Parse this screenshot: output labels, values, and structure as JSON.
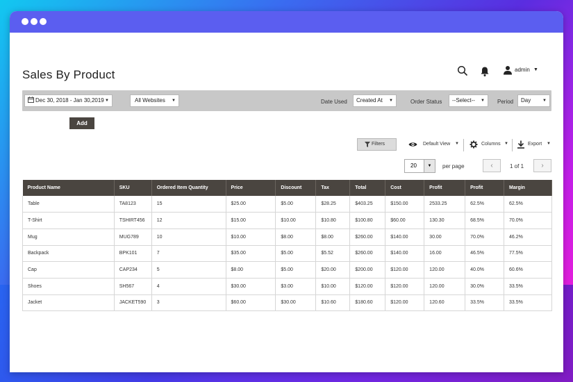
{
  "page_title": "Sales By Product",
  "user": {
    "name": "admin"
  },
  "icons": {
    "search": "search-icon",
    "bell": "bell-icon",
    "user": "user-icon",
    "calendar": "calendar-icon",
    "filter": "filter-icon",
    "eye": "eye-icon",
    "gear": "gear-icon",
    "download": "download-icon"
  },
  "filterbar": {
    "date_range": "Dec 30, 2018 - Jan 30,2019",
    "website": "All Websites",
    "date_used_label": "Date Used",
    "date_used_value": "Created At",
    "order_status_label": "Order Status",
    "order_status_value": "--Select--",
    "period_label": "Period",
    "period_value": "Day"
  },
  "add_label": "Add",
  "toolbar": {
    "filters_label": "Filters",
    "default_view_label": "Default View",
    "columns_label": "Columns",
    "export_label": "Export"
  },
  "pagination": {
    "per_page_value": "20",
    "per_page_label": "per page",
    "prev": "‹",
    "next": "›",
    "page_info": "1 of 1"
  },
  "table": {
    "headers": [
      "Product Name",
      "SKU",
      "Ordered Item Quantity",
      "Price",
      "Discount",
      "Tax",
      "Total",
      "Cost",
      "Profit",
      "Profit",
      "Margin"
    ],
    "rows": [
      [
        "Table",
        "TA8123",
        "15",
        "$25.00",
        "$5.00",
        "$28.25",
        "$403.25",
        "$150.00",
        "2533.25",
        "62.5%",
        "62.5%"
      ],
      [
        "T-Shirt",
        "TSHIRT456",
        "12",
        "$15.00",
        "$10.00",
        "$10.80",
        "$100.80",
        "$60.00",
        "130.30",
        "68.5%",
        "70.0%"
      ],
      [
        "Mug",
        "MUG789",
        "10",
        "$10.00",
        "$8.00",
        "$8.00",
        "$260.00",
        "$140.00",
        "30.00",
        "70.0%",
        "46.2%"
      ],
      [
        "Backpack",
        "BPK101",
        "7",
        "$35.00",
        "$5.00",
        "$5.52",
        "$260.00",
        "$140.00",
        "16.00",
        "46.5%",
        "77.5%"
      ],
      [
        "Cap",
        "CAP234",
        "5",
        "$8.00",
        "$5.00",
        "$20.00",
        "$200.00",
        "$120.00",
        "120.00",
        "40.0%",
        "60.6%"
      ],
      [
        "Shoes",
        "SH567",
        "4",
        "$30.00",
        "$3.00",
        "$10.00",
        "$120.00",
        "$120.00",
        "120.00",
        "30.0%",
        "33.5%"
      ],
      [
        "Jacket",
        "JACKET590",
        "3",
        "$60.00",
        "$30.00",
        "$10.60",
        "$180.60",
        "$120.00",
        "120.60",
        "33.5%",
        "33.5%"
      ]
    ]
  },
  "colors": {
    "titlebar": "#5b5ef0",
    "table_header": "#4a4540",
    "filterbar": "#c8c8c8"
  }
}
